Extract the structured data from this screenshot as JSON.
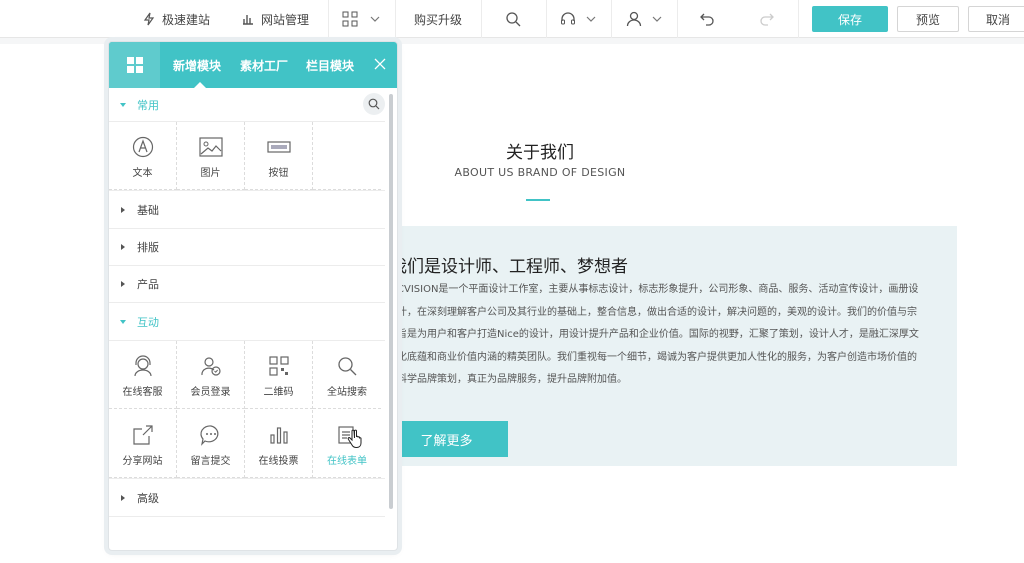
{
  "topbar": {
    "quick_build": "极速建站",
    "site_manage": "网站管理",
    "upgrade": "购买升级",
    "save": "保存",
    "preview": "预览",
    "cancel": "取消"
  },
  "page": {
    "title": "关于我们",
    "subtitle": "ABOUT US BRAND OF DESIGN",
    "heading": "我们是设计师、工程师、梦想者",
    "paragraph": "CVISION是一个平面设计工作室，主要从事标志设计，标志形象提升，公司形象、商品、服务、活动宣传设计，画册设计，在深刻理解客户公司及其行业的基础上，整合信息，做出合适的设计，解决问题的，美观的设计。我们的价值与宗旨是为用户和客户打造Nice的设计，用设计提升产品和企业价值。国际的视野，汇聚了策划，设计人才，是融汇深厚文化底蕴和商业价值内涵的精英团队。我们重视每一个细节，竭诚为客户提供更加人性化的服务，为客户创造市场价值的科学品牌策划，真正为品牌服务，提升品牌附加值。",
    "more_button": "了解更多"
  },
  "panel": {
    "tabs": [
      "新增模块",
      "素材工厂",
      "栏目模块"
    ],
    "categories": {
      "common": "常用",
      "basic": "基础",
      "layout": "排版",
      "product": "产品",
      "interactive": "互动",
      "advanced": "高级"
    },
    "common_items": [
      {
        "label": "文本",
        "icon": "text-icon"
      },
      {
        "label": "图片",
        "icon": "image-icon"
      },
      {
        "label": "按钮",
        "icon": "button-icon"
      }
    ],
    "interactive_items": [
      {
        "label": "在线客服",
        "icon": "customer-service-icon"
      },
      {
        "label": "会员登录",
        "icon": "member-login-icon"
      },
      {
        "label": "二维码",
        "icon": "qrcode-icon"
      },
      {
        "label": "全站搜索",
        "icon": "site-search-icon"
      },
      {
        "label": "分享网站",
        "icon": "share-icon"
      },
      {
        "label": "留言提交",
        "icon": "message-icon"
      },
      {
        "label": "在线投票",
        "icon": "vote-icon"
      },
      {
        "label": "在线表单",
        "icon": "form-icon"
      }
    ]
  },
  "colors": {
    "accent": "#41c3c6",
    "box_bg": "#e9f2f4"
  }
}
